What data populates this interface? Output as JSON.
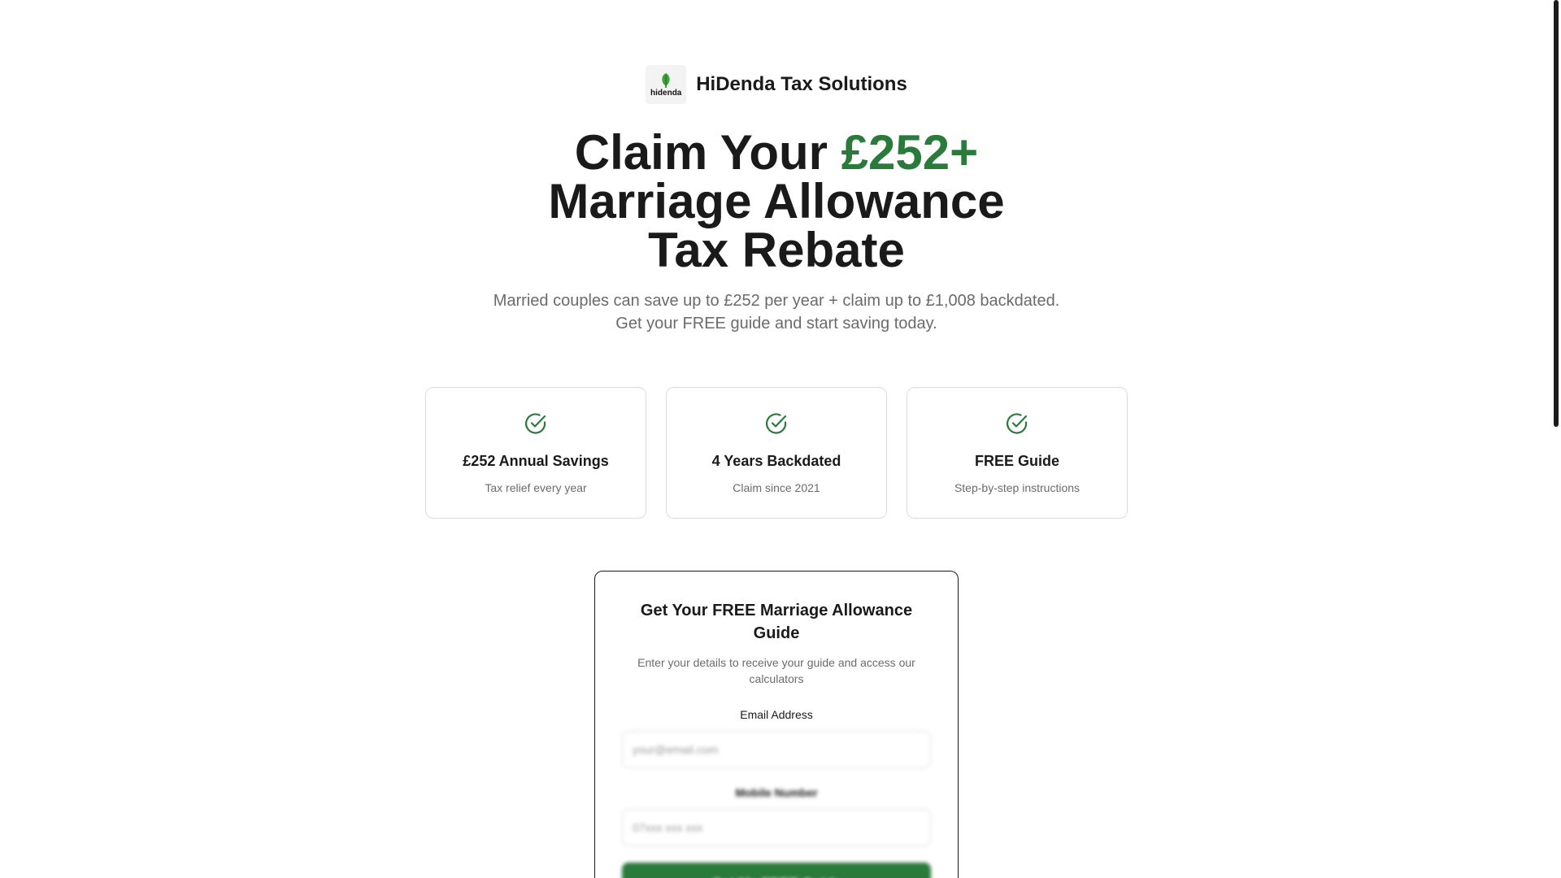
{
  "brand": {
    "logo_text": "hidenda",
    "name": "HiDenda Tax Solutions"
  },
  "hero": {
    "line1_prefix": "Claim Your ",
    "line1_accent": "£252+",
    "line2": "Marriage Allowance",
    "line3": "Tax Rebate",
    "accent_color": "#2a7a3b"
  },
  "subtitle": {
    "line1": "Married couples can save up to £252 per year + claim up to £1,008 backdated.",
    "line2": "Get your FREE guide and start saving today."
  },
  "features": [
    {
      "icon": "check-circle-icon",
      "title": "£252 Annual Savings",
      "desc": "Tax relief every year"
    },
    {
      "icon": "check-circle-icon",
      "title": "4 Years Backdated",
      "desc": "Claim since 2021"
    },
    {
      "icon": "check-circle-icon",
      "title": "FREE Guide",
      "desc": "Step-by-step instructions"
    }
  ],
  "form": {
    "title": "Get Your FREE Marriage Allowance Guide",
    "desc": "Enter your details to receive your guide and access our calculators",
    "email_label": "Email Address",
    "email_placeholder": "your@email.com",
    "mobile_label": "Mobile Number",
    "mobile_placeholder": "07xxx xxx xxx",
    "submit_label": "Get My FREE Guide",
    "button_color": "#2a7a3b"
  }
}
